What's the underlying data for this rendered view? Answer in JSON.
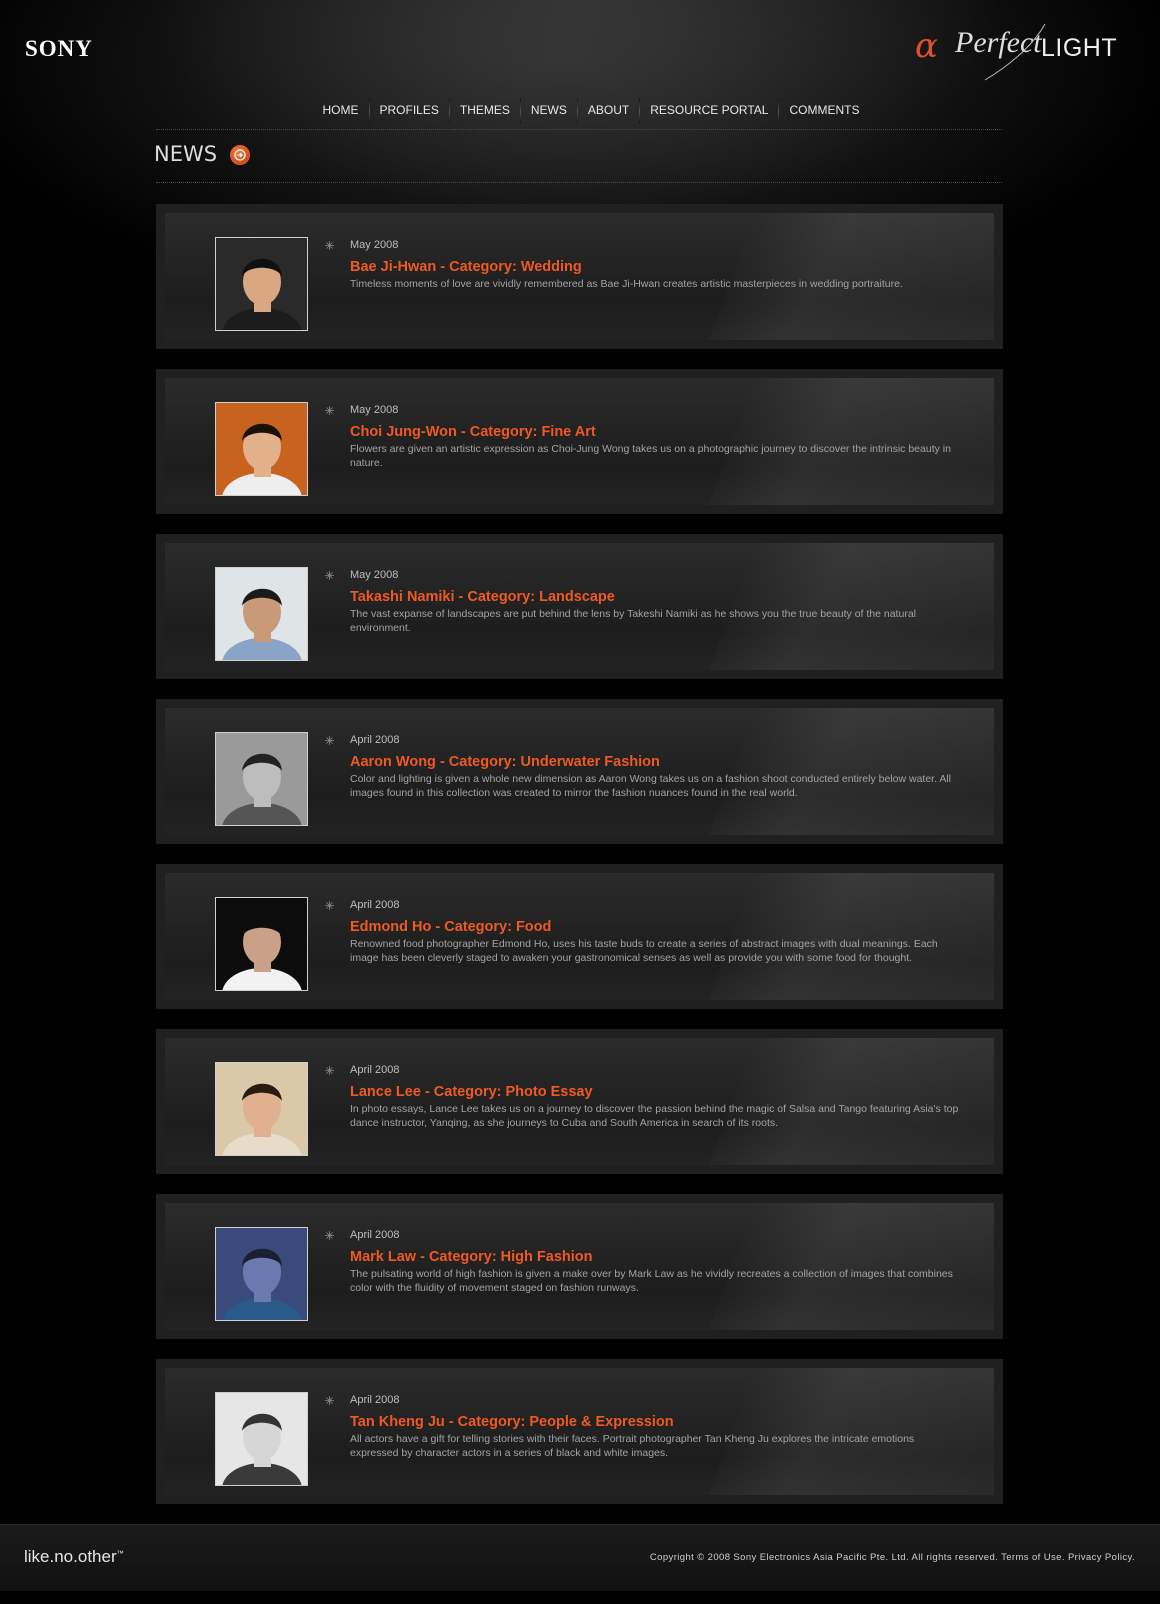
{
  "header": {
    "brand": "SONY",
    "site_logo": {
      "alpha": "α",
      "perfect": "Perfect",
      "light": "LIGHT"
    },
    "accent_color": "#ef5a22"
  },
  "nav": {
    "items": [
      {
        "label": "HOME"
      },
      {
        "label": "PROFILES"
      },
      {
        "label": "THEMES"
      },
      {
        "label": "NEWS"
      },
      {
        "label": "ABOUT"
      },
      {
        "label": "RESOURCE PORTAL"
      },
      {
        "label": "COMMENTS"
      }
    ]
  },
  "section": {
    "title": "NEWS",
    "arrow_icon": "arrow-right-circle-icon"
  },
  "news": [
    {
      "date": "May 2008",
      "title": "Bae Ji-Hwan - Category: Wedding",
      "description": "Timeless moments of love are vividly remembered as Bae Ji-Hwan creates artistic masterpieces in wedding portraiture.",
      "photo_bg": "#2a2a2a"
    },
    {
      "date": "May 2008",
      "title": "Choi Jung-Won - Category: Fine Art",
      "description": "Flowers are given an artistic expression as Choi-Jung Wong takes us on a photographic journey to discover the intrinsic beauty in nature.",
      "photo_bg": "#c8621f"
    },
    {
      "date": "May 2008",
      "title": "Takashi Namiki - Category: Landscape",
      "description": "The vast expanse of landscapes are put behind the lens by Takeshi Namiki as he shows you the true beauty of the natural environment.",
      "photo_bg": "#dfe4e6"
    },
    {
      "date": "April 2008",
      "title": "Aaron Wong - Category: Underwater Fashion",
      "description": "Color and lighting is given a whole new dimension as Aaron Wong takes us on a fashion shoot conducted entirely below water. All images found in this collection was created to mirror the fashion nuances found in the real world.",
      "photo_bg": "#9a9a9a"
    },
    {
      "date": "April 2008",
      "title": "Edmond Ho - Category: Food",
      "description": "Renowned food photographer Edmond Ho, uses his taste buds to create a series of abstract images with dual meanings. Each image has been cleverly staged to awaken your gastronomical senses as well as provide you with some food for thought.",
      "photo_bg": "#0c0c0c"
    },
    {
      "date": "April 2008",
      "title": "Lance Lee - Category: Photo Essay",
      "description": "In photo essays, Lance Lee takes us on a journey to discover the passion behind the magic of Salsa and Tango featuring Asia's top dance instructor, Yanqing, as she journeys to Cuba and South America in search of its roots.",
      "photo_bg": "#d9c9a8"
    },
    {
      "date": "April 2008",
      "title": "Mark Law - Category: High Fashion",
      "description": "The pulsating world of high fashion is given a make over by Mark Law as he vividly recreates a collection of images that combines color with the fluidity of movement staged on fashion runways.",
      "photo_bg": "#3a4a7a"
    },
    {
      "date": "April 2008",
      "title": "Tan Kheng Ju - Category: People & Expression",
      "description": "All actors have a gift for telling stories with their faces. Portrait photographer Tan Kheng Ju explores the intricate emotions expressed by character actors in a series of black and white images.",
      "photo_bg": "#e6e6e6"
    }
  ],
  "footer": {
    "tagline": "like.no.other",
    "tagline_tm": "™",
    "copyright": "Copyright © 2008 Sony Electronics Asia Pacific Pte. Ltd. All rights reserved.",
    "terms": "Terms of Use.",
    "privacy": "Privacy Policy."
  }
}
